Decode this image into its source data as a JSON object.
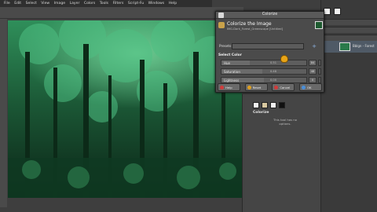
{
  "menubar": {
    "items": [
      "File",
      "Edit",
      "Select",
      "View",
      "Image",
      "Layer",
      "Colors",
      "Tools",
      "Filters",
      "Script-Fu",
      "Windows",
      "Help"
    ]
  },
  "dialog": {
    "title": "Colorize",
    "heading": "Colorize the Image",
    "subheading": "IMG-Dark_Forest_Greenscape [Untitled]",
    "presets_label": "Presets:",
    "presets_value": "",
    "section_label": "Select Color",
    "sliders": [
      {
        "label": "Hue",
        "value": "84",
        "track_text": "0.51",
        "fraction": 0.33
      },
      {
        "label": "Saturation",
        "value": "48",
        "track_text": "0.48",
        "fraction": 0.48
      },
      {
        "label": "Lightness",
        "value": "0",
        "track_text": "0.00",
        "fraction": 0.5
      }
    ],
    "preview_label": "Preview",
    "preview_checked": true,
    "buttons": {
      "help": "Help",
      "reset": "Reset",
      "cancel": "Cancel",
      "ok": "OK"
    }
  },
  "tool_options": {
    "name": "Colorize",
    "note": "This tool has no options."
  },
  "layers": {
    "layer_name": "Bblgn - Forest"
  },
  "colors": {
    "accent": "#2f8f5a",
    "help_icon": "#d13b3b",
    "reset_icon": "#e0a020",
    "cancel_icon": "#d13b3b",
    "ok_icon": "#4a8fd9"
  }
}
